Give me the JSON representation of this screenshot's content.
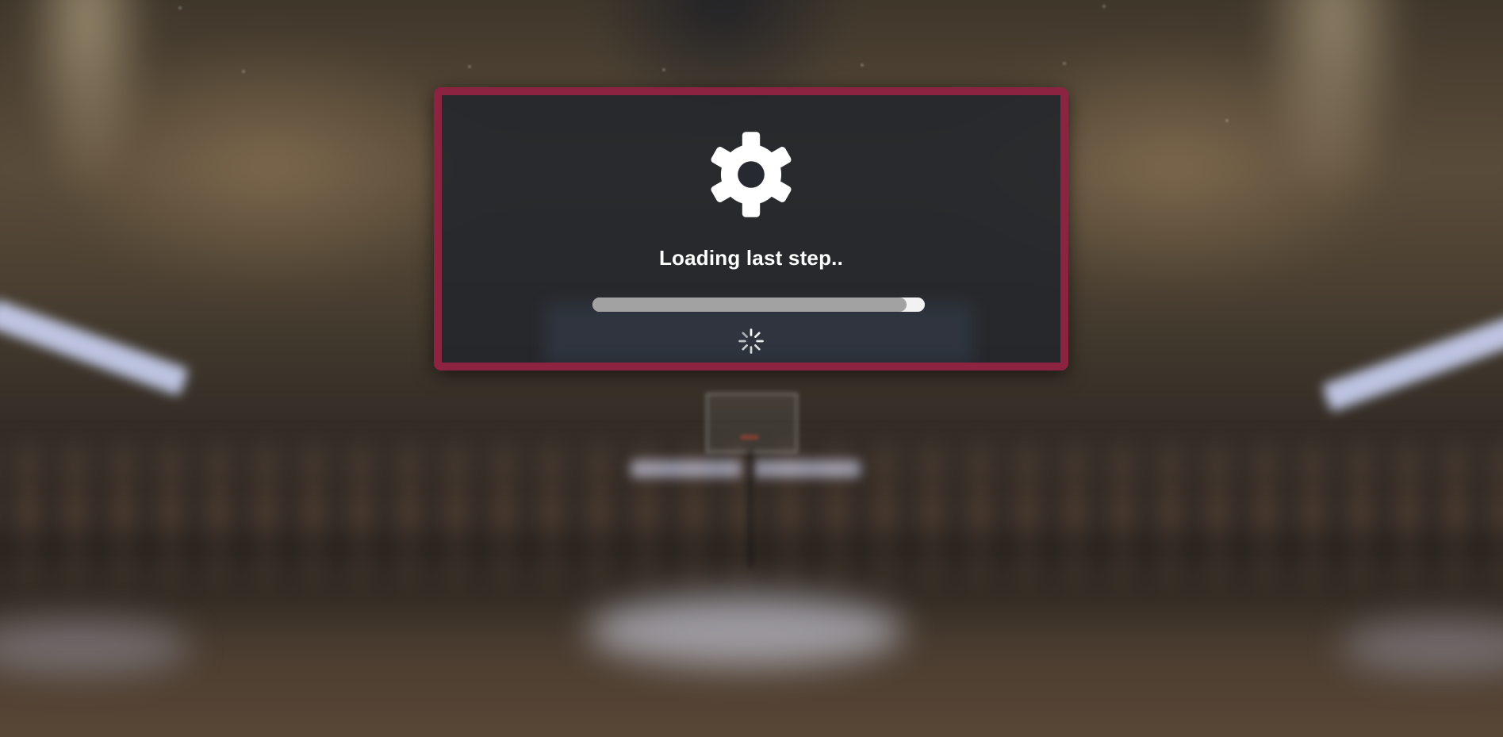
{
  "loading": {
    "message": "Loading last step..",
    "progress_fraction": 0.945
  },
  "icons": {
    "main": "gear-icon",
    "busy": "spinner-icon"
  },
  "colors": {
    "dialog_border": "#8b2341",
    "dialog_background": "#22252b",
    "progress_track": "#f2f2f2",
    "progress_fill": "#a2a2a2",
    "text": "#ffffff"
  }
}
